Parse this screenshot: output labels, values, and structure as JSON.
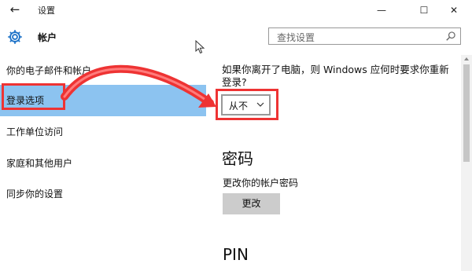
{
  "window": {
    "title": "设置",
    "back_icon": "←",
    "minimize": "—",
    "maximize": "☐",
    "close": "✕"
  },
  "header": {
    "section_title": "帐户",
    "search_placeholder": "查找设置"
  },
  "sidebar": {
    "items": [
      {
        "label": "你的电子邮件和帐户",
        "selected": false
      },
      {
        "label": "登录选项",
        "selected": true
      },
      {
        "label": "工作单位访问",
        "selected": false
      },
      {
        "label": "家庭和其他用户",
        "selected": false
      },
      {
        "label": "同步你的设置",
        "selected": false
      }
    ]
  },
  "content": {
    "require_signin_question": "如果你离开了电脑，则 Windows 应何时要求你重新登录?",
    "require_signin_value": "从不",
    "password_heading": "密码",
    "password_label": "更改你的帐户密码",
    "password_button": "更改",
    "pin_heading": "PIN"
  },
  "colors": {
    "selected_nav_bg": "#8cc3f0",
    "highlight_red": "#e33",
    "accent_blue": "#1e73c8"
  }
}
